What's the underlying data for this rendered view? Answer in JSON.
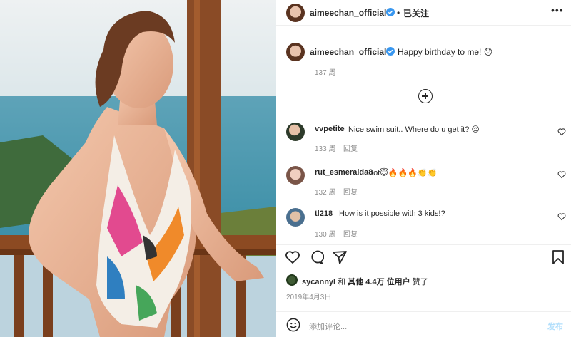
{
  "header": {
    "username": "aimeechan_official",
    "dot": "•",
    "follow_status": "已关注",
    "more": "•••"
  },
  "caption": {
    "username": "aimeechan_official",
    "text": "Happy birthday to me! 😯",
    "time": "137 周"
  },
  "comments": [
    {
      "username": "vvpetite",
      "text": "Nice swim suit.. Where do u get it? 😌",
      "time": "133 周",
      "reply": "回复"
    },
    {
      "username": "rut_esmeralda8",
      "text": "hot😇🔥🔥🔥👏👏",
      "time": "132 周",
      "reply": "回复"
    },
    {
      "username": "tl218",
      "text": "How is it possible with 3 kids!?",
      "time": "130 周",
      "reply": "回复"
    }
  ],
  "likes": {
    "user": "sycannyl",
    "and": "和",
    "others_prefix": "其他",
    "count": "4.4万",
    "others_suffix": "位用户",
    "liked": "赞了"
  },
  "date": "2019年4月3日",
  "add_comment": {
    "placeholder": "添加评论...",
    "post": "发布"
  },
  "colors": {
    "verified": "#3897f0",
    "post_disabled": "#b2dffc",
    "muted": "#8e8e8e"
  },
  "icons": [
    "verified-badge-icon",
    "load-more-icon",
    "heart-icon",
    "comment-icon",
    "share-icon",
    "bookmark-icon",
    "emoji-icon"
  ]
}
